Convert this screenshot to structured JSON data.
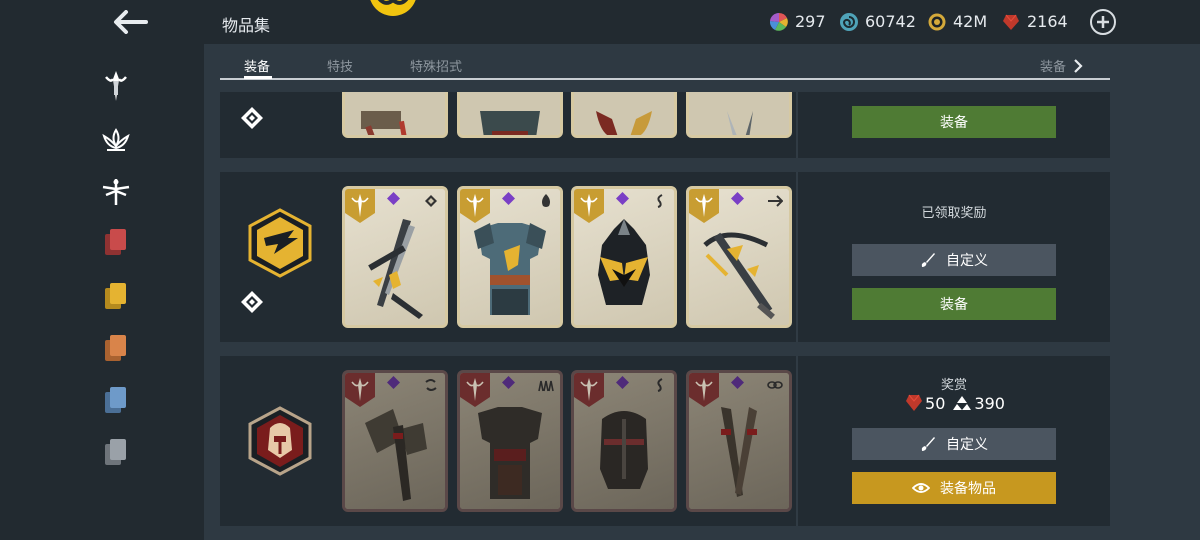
{
  "header": {
    "title": "物品集",
    "currencies": [
      {
        "name": "spectrum",
        "value": "297",
        "icon": "color-wheel-icon"
      },
      {
        "name": "steel",
        "value": "60742",
        "icon": "swirl-icon"
      },
      {
        "name": "coins",
        "value": "42M",
        "icon": "coin-icon"
      },
      {
        "name": "gems",
        "value": "2164",
        "icon": "ruby-icon"
      }
    ]
  },
  "tabs": {
    "items": [
      "装备",
      "特技",
      "特殊招式"
    ],
    "active": "装备",
    "right_label": "装备"
  },
  "sidebar": {
    "items": [
      {
        "name": "sword-emblem-icon",
        "color": "#ffffff"
      },
      {
        "name": "lotus-icon",
        "color": "#ffffff"
      },
      {
        "name": "dragonfly-icon",
        "color": "#ffffff"
      },
      {
        "name": "cards-red-icon",
        "color": "#c94b4b"
      },
      {
        "name": "cards-yellow-icon",
        "color": "#e5b331"
      },
      {
        "name": "cards-orange-icon",
        "color": "#d9844a"
      },
      {
        "name": "cards-blue-icon",
        "color": "#6e9ac9"
      },
      {
        "name": "cards-gray-icon",
        "color": "#9aa1a8"
      }
    ]
  },
  "rows": [
    {
      "status": "",
      "buttons": [
        "装备"
      ]
    },
    {
      "status": "已领取奖励",
      "buttons": [
        "自定义",
        "装备"
      ]
    },
    {
      "status": "奖赏",
      "reward": {
        "gems": "50",
        "shards": "390"
      },
      "buttons": [
        "自定义",
        "装备物品"
      ]
    }
  ],
  "colors": {
    "equip_green": "#4f7b34",
    "customize_gray": "#4b5560",
    "equip_items_gold": "#c7981f",
    "rarity_purple": "#7a3fc5"
  }
}
